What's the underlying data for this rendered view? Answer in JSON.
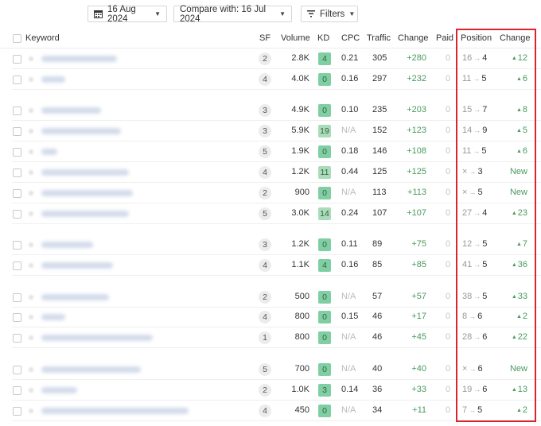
{
  "toolbar": {
    "date_label": "16 Aug 2024",
    "compare_label": "Compare with: 16 Jul 2024",
    "filters_label": "Filters"
  },
  "table": {
    "columns": {
      "keyword": "Keyword",
      "sf": "SF",
      "volume": "Volume",
      "kd": "KD",
      "cpc": "CPC",
      "traffic": "Traffic",
      "change": "Change",
      "paid": "Paid",
      "position": "Position",
      "position_change": "Change"
    },
    "rows": [
      {
        "sf": "2",
        "volume": "2.8K",
        "kd": "4",
        "cpc": "0.21",
        "traffic": "305",
        "change": "+280",
        "paid": "0",
        "pos_from": "16",
        "pos_to": "4",
        "pos_change": "12",
        "is_new": false
      },
      {
        "sf": "4",
        "volume": "4.0K",
        "kd": "0",
        "cpc": "0.16",
        "traffic": "297",
        "change": "+232",
        "paid": "0",
        "pos_from": "11",
        "pos_to": "5",
        "pos_change": "6",
        "is_new": false
      },
      {
        "sf": "3",
        "volume": "4.9K",
        "kd": "0",
        "cpc": "0.10",
        "traffic": "235",
        "change": "+203",
        "paid": "0",
        "pos_from": "15",
        "pos_to": "7",
        "pos_change": "8",
        "is_new": false
      },
      {
        "sf": "3",
        "volume": "5.9K",
        "kd": "19",
        "cpc": "N/A",
        "traffic": "152",
        "change": "+123",
        "paid": "0",
        "pos_from": "14",
        "pos_to": "9",
        "pos_change": "5",
        "is_new": false
      },
      {
        "sf": "5",
        "volume": "1.9K",
        "kd": "0",
        "cpc": "0.18",
        "traffic": "146",
        "change": "+108",
        "paid": "0",
        "pos_from": "11",
        "pos_to": "5",
        "pos_change": "6",
        "is_new": false
      },
      {
        "sf": "4",
        "volume": "1.2K",
        "kd": "11",
        "cpc": "0.44",
        "traffic": "125",
        "change": "+125",
        "paid": "0",
        "pos_from": "×",
        "pos_to": "3",
        "pos_change": "New",
        "is_new": true
      },
      {
        "sf": "2",
        "volume": "900",
        "kd": "0",
        "cpc": "N/A",
        "traffic": "113",
        "change": "+113",
        "paid": "0",
        "pos_from": "×",
        "pos_to": "5",
        "pos_change": "New",
        "is_new": true
      },
      {
        "sf": "5",
        "volume": "3.0K",
        "kd": "14",
        "cpc": "0.24",
        "traffic": "107",
        "change": "+107",
        "paid": "0",
        "pos_from": "27",
        "pos_to": "4",
        "pos_change": "23",
        "is_new": false
      },
      {
        "sf": "3",
        "volume": "1.2K",
        "kd": "0",
        "cpc": "0.11",
        "traffic": "89",
        "change": "+75",
        "paid": "0",
        "pos_from": "12",
        "pos_to": "5",
        "pos_change": "7",
        "is_new": false
      },
      {
        "sf": "4",
        "volume": "1.1K",
        "kd": "4",
        "cpc": "0.16",
        "traffic": "85",
        "change": "+85",
        "paid": "0",
        "pos_from": "41",
        "pos_to": "5",
        "pos_change": "36",
        "is_new": false
      },
      {
        "sf": "2",
        "volume": "500",
        "kd": "0",
        "cpc": "N/A",
        "traffic": "57",
        "change": "+57",
        "paid": "0",
        "pos_from": "38",
        "pos_to": "5",
        "pos_change": "33",
        "is_new": false
      },
      {
        "sf": "4",
        "volume": "800",
        "kd": "0",
        "cpc": "0.15",
        "traffic": "46",
        "change": "+17",
        "paid": "0",
        "pos_from": "8",
        "pos_to": "6",
        "pos_change": "2",
        "is_new": false
      },
      {
        "sf": "1",
        "volume": "800",
        "kd": "0",
        "cpc": "N/A",
        "traffic": "46",
        "change": "+45",
        "paid": "0",
        "pos_from": "28",
        "pos_to": "6",
        "pos_change": "22",
        "is_new": false
      },
      {
        "sf": "5",
        "volume": "700",
        "kd": "0",
        "cpc": "N/A",
        "traffic": "40",
        "change": "+40",
        "paid": "0",
        "pos_from": "×",
        "pos_to": "6",
        "pos_change": "New",
        "is_new": true
      },
      {
        "sf": "2",
        "volume": "1.0K",
        "kd": "3",
        "cpc": "0.14",
        "traffic": "36",
        "change": "+33",
        "paid": "0",
        "pos_from": "19",
        "pos_to": "6",
        "pos_change": "13",
        "is_new": false
      },
      {
        "sf": "4",
        "volume": "450",
        "kd": "0",
        "cpc": "N/A",
        "traffic": "34",
        "change": "+11",
        "paid": "0",
        "pos_from": "7",
        "pos_to": "5",
        "pos_change": "2",
        "is_new": false
      }
    ]
  },
  "colors": {
    "positive": "#4a9a5e",
    "kd_easy": "#7fcfa3",
    "kd_medium": "#a9dcb9",
    "highlight_border": "#d9262e"
  }
}
